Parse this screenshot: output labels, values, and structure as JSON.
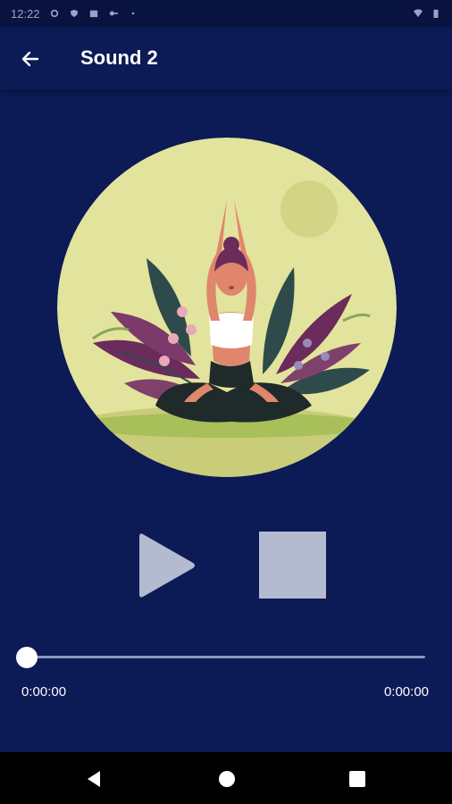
{
  "status_bar": {
    "time": "12:22",
    "icons": [
      "settings-icon",
      "shield-icon",
      "calendar-icon",
      "key-icon",
      "dot-icon",
      "wifi-icon",
      "battery-icon"
    ]
  },
  "header": {
    "title": "Sound 2",
    "back_icon": "arrow-left-icon"
  },
  "player": {
    "artwork": "meditation-illustration",
    "play_icon": "play-icon",
    "stop_icon": "stop-icon",
    "progress": 0,
    "current_time": "0:00:00",
    "total_time": "0:00:00"
  },
  "nav_bar": {
    "icons": [
      "nav-back-icon",
      "nav-home-icon",
      "nav-recents-icon"
    ]
  },
  "colors": {
    "background": "#0c1a56",
    "status_bar": "#081340",
    "artwork_circle": "#e2e39c",
    "control": "#b4bbd0",
    "seek_track": "#8e97bd"
  }
}
